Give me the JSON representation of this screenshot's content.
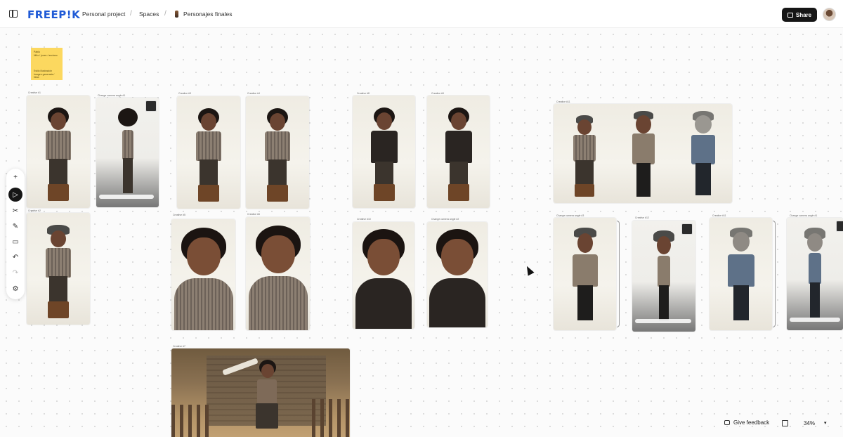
{
  "header": {
    "logo": "FREEP!K",
    "breadcrumb": [
      "Personal project",
      "Spaces",
      "Personajes finales"
    ],
    "separator": "/",
    "share_label": "Share"
  },
  "sticky_note": {
    "line1": "Pablo",
    "line2": "Niño / joven / anciano",
    "line3": "Estilo illustración",
    "line4": "Imagen generada / Nota"
  },
  "card_labels": {
    "creative_a": "Creative #1",
    "creative_b": "Change camera angle #1",
    "creative_c": "Creative #2",
    "creative_d": "Creative #3",
    "creative_e": "Creative #4",
    "creative_f": "Creative #5",
    "creative_g": "Creative #6",
    "creative_h": "Creative #7",
    "creative_i": "Creative #8",
    "creative_j": "Creative #9",
    "creative_k": "Creative #10",
    "creative_l": "Change camera angle #2",
    "creative_m": "Creative #11",
    "creative_n": "Change camera angle #3",
    "creative_o": "Creative #12"
  },
  "toolbar": {
    "add": "+",
    "select": "▷",
    "cut": "✂",
    "draw": "✎",
    "comment": "▭",
    "undo": "↶",
    "redo": "↷",
    "settings": "⚙"
  },
  "footer": {
    "feedback_label": "Give feedback",
    "zoom_level": "34%",
    "zoom_caret": "▾"
  },
  "colors": {
    "brand": "#1f5ad6",
    "sticky": "#fcd85f",
    "dark": "#161616"
  }
}
